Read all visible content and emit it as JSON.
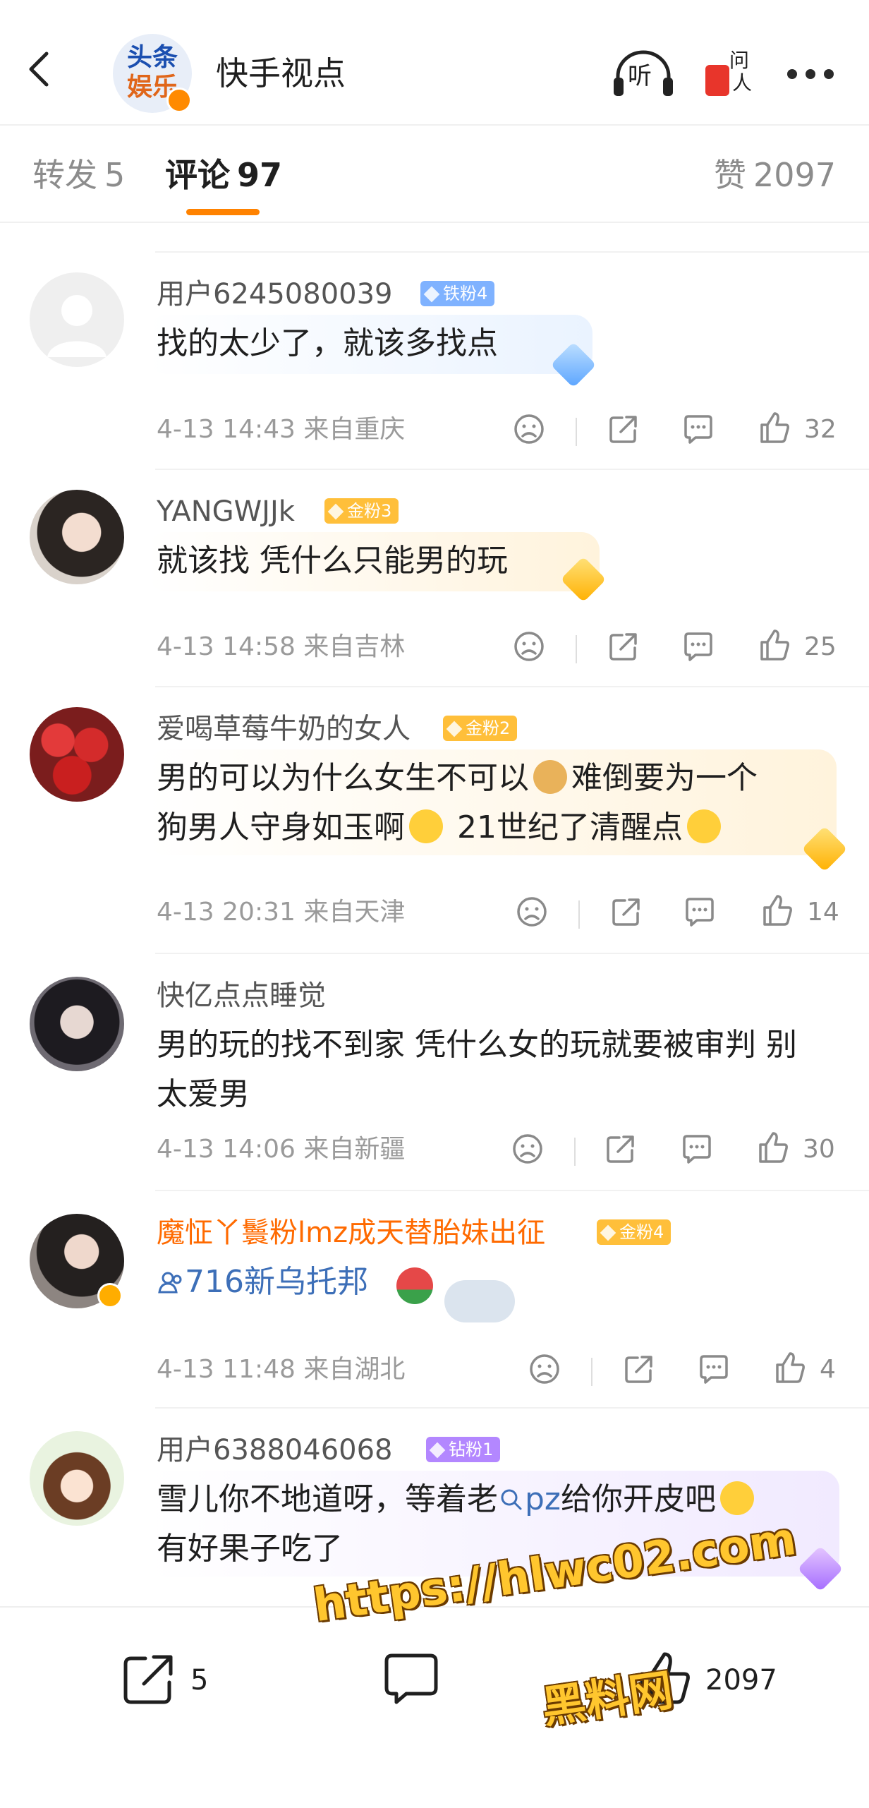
{
  "header": {
    "title": "快手视点",
    "avatar_line1": "头条",
    "avatar_line2": "娱乐",
    "listen_label": "听",
    "ask_label_1": "问",
    "ask_label_2": "人"
  },
  "tabs": {
    "repost_label": "转发",
    "repost_count": "5",
    "comment_label": "评论",
    "comment_count": "97",
    "like_label": "赞",
    "like_count": "2097",
    "accent_color": "#ff8200"
  },
  "comments": [
    {
      "username": "用户6245080039",
      "badge": "铁粉4",
      "text": "找的太少了，就该多找点",
      "time": "4-13 14:43",
      "location": "来自重庆",
      "likes": "32"
    },
    {
      "username": "YANGWJJk",
      "badge": "金粉3",
      "text": "就该找 凭什么只能男的玩",
      "time": "4-13 14:58",
      "location": "来自吉林",
      "likes": "25"
    },
    {
      "username": "爱喝草莓牛奶的女人",
      "badge": "金粉2",
      "text_line1a": "男的可以为什么女生不可以",
      "text_line1b": "难倒要为一个",
      "text_line2a": "狗男人守身如玉啊",
      "text_line2b": "21世纪了清醒点",
      "time": "4-13 20:31",
      "location": "来自天津",
      "likes": "14"
    },
    {
      "username": "快亿点点睡觉",
      "text_line1": "男的玩的找不到家 凭什么女的玩就要被审判 别",
      "text_line2": "太爱男",
      "time": "4-13 14:06",
      "location": "来自新疆",
      "likes": "30"
    },
    {
      "username": "魔怔丫鬟粉lmz成天替胎妹出征",
      "badge": "金粉4",
      "text": "716新乌托邦",
      "time": "4-13 11:48",
      "location": "来自湖北",
      "likes": "4"
    },
    {
      "username": "用户6388046068",
      "badge": "钻粉1",
      "text_line1a": "雪儿你不地道呀，等着老",
      "text_line1_search": "pz",
      "text_line1b": "给你开皮吧",
      "text_line2": "有好果子吃了"
    }
  ],
  "bottom_bar": {
    "share_count": "5",
    "like_count": "2097"
  },
  "watermark": {
    "url": "https://hlwc02.com",
    "name": "黑料网"
  },
  "icons": {
    "back": "back-arrow-icon",
    "listen": "headphones-icon",
    "ask": "red-envelope-icon",
    "more": "more-dots-icon",
    "dislike": "sad-face-icon",
    "share": "share-icon",
    "comment": "comment-icon",
    "like": "thumbs-up-icon"
  }
}
